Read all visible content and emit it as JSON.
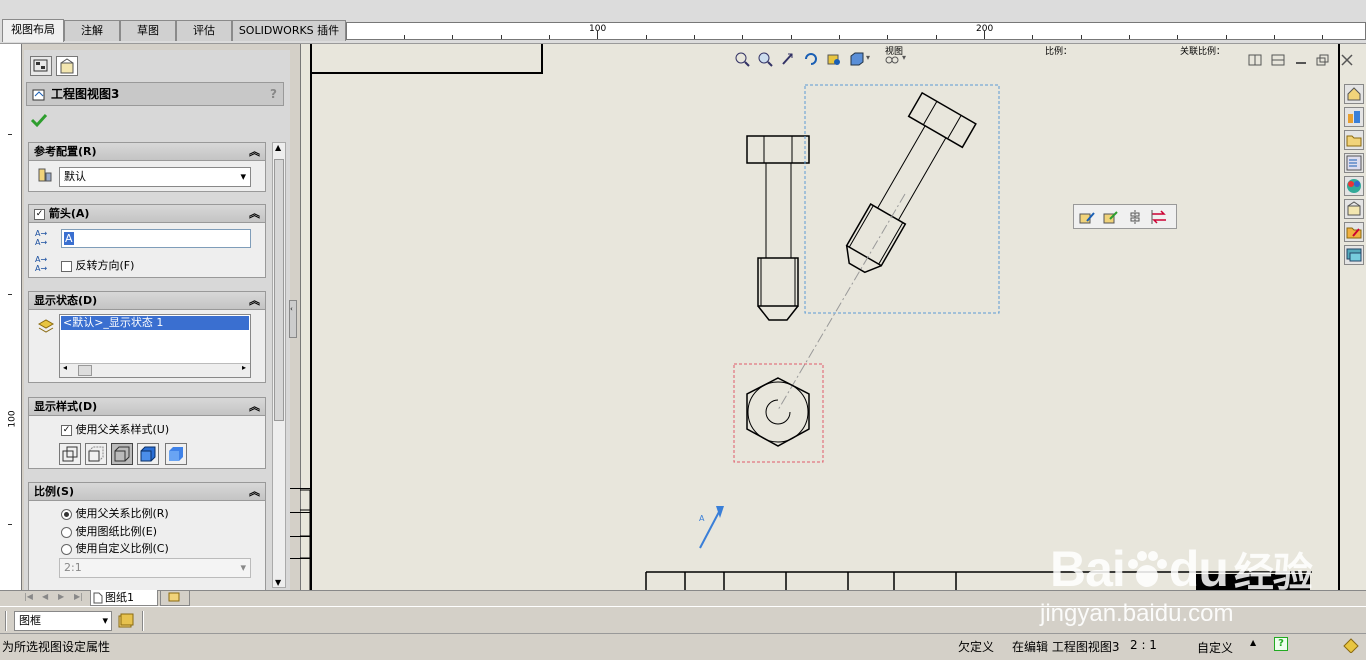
{
  "tabs": [
    {
      "label": "视图布局",
      "active": true
    },
    {
      "label": "注解",
      "active": false
    },
    {
      "label": "草图",
      "active": false
    },
    {
      "label": "评估",
      "active": false
    },
    {
      "label": "SOLIDWORKS 插件",
      "active": false
    }
  ],
  "ruler_top": {
    "labels": [
      "100",
      "200"
    ]
  },
  "ruler_left": {
    "label": "100"
  },
  "property_manager": {
    "title": "工程图视图3",
    "help": "?",
    "sections": {
      "ref_config": {
        "title": "参考配置(R)",
        "value": "默认"
      },
      "arrow": {
        "title": "箭头(A)",
        "label_value": "A",
        "reverse_label": "反转方向(F)"
      },
      "display_state": {
        "title": "显示状态(D)",
        "selected_item": "<默认>_显示状态 1"
      },
      "display_style": {
        "title": "显示样式(D)",
        "use_parent_label": "使用父关系样式(U)"
      },
      "scale": {
        "title": "比例(S)",
        "option_parent": "使用父关系比例(R)",
        "option_sheet": "使用图纸比例(E)",
        "option_custom": "使用自定义比例(C)",
        "custom_value": "2:1"
      }
    }
  },
  "sheet_tabs": {
    "active": "图纸1"
  },
  "layer_select": {
    "value": "图框"
  },
  "drawing": {
    "view_arrow_label": "A",
    "header_fragments": [
      "视图",
      "比例：",
      "关联比例："
    ]
  },
  "status_bar": {
    "message": "为所选视图设定属性",
    "constraint": "欠定义",
    "editing": "在编辑 工程图视图3",
    "scale": "2 : 1",
    "units": "自定义",
    "units_arrow": "▲",
    "help": "?"
  },
  "watermark": {
    "brand": "Bai",
    "brand2": "du",
    "suffix": "经验",
    "url": "jingyan.baidu.com"
  },
  "colors": {
    "selection_blue": "#5b9bd5",
    "selection_red": "#e05a6a",
    "sheet_bg": "#e8e6dc",
    "panel_bg": "#d4d0c8"
  }
}
